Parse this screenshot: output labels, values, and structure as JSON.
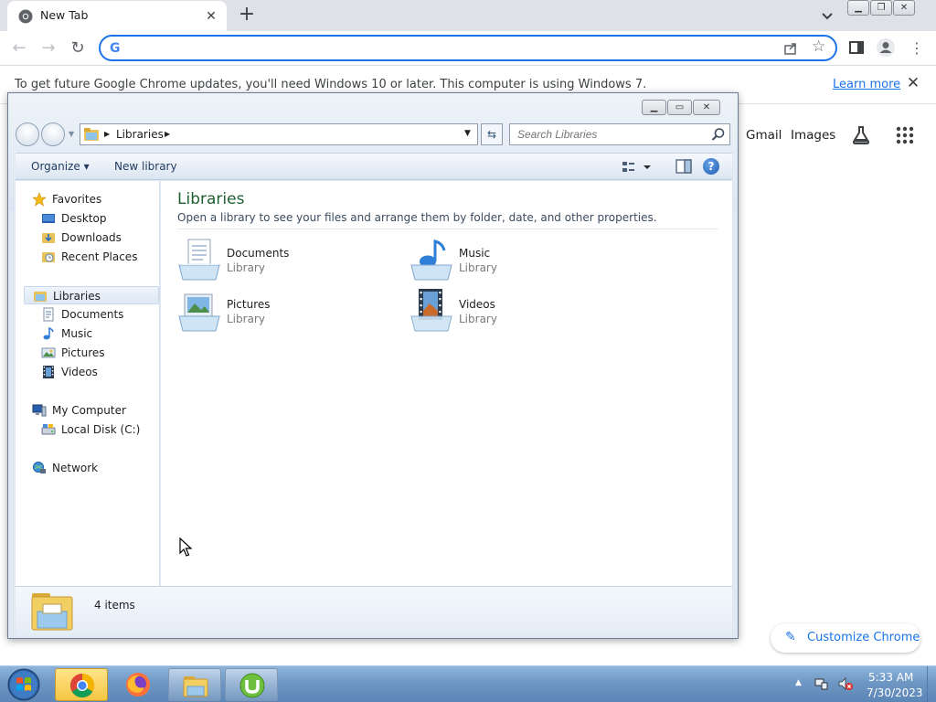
{
  "chrome": {
    "tab_title": "New Tab",
    "omnibox_value": "",
    "omnibox_placeholder": "",
    "infobar_message": "To get future Google Chrome updates, you'll need Windows 10 or later. This computer is using Windows 7.",
    "infobar_link": "Learn more",
    "ntp_links": {
      "gmail": "Gmail",
      "images": "Images"
    },
    "customize_label": "Customize Chrome",
    "accent_color": "#1a73e8"
  },
  "explorer": {
    "breadcrumb": [
      "Libraries"
    ],
    "search_placeholder": "Search Libraries",
    "toolbar": {
      "organize": "Organize",
      "new_library": "New library"
    },
    "nav": {
      "favorites": "Favorites",
      "favorites_items": [
        "Desktop",
        "Downloads",
        "Recent Places"
      ],
      "libraries": "Libraries",
      "libraries_items": [
        "Documents",
        "Music",
        "Pictures",
        "Videos"
      ],
      "computer": "My Computer",
      "computer_items": [
        "Local Disk (C:)"
      ],
      "network": "Network"
    },
    "content": {
      "title": "Libraries",
      "subtitle": "Open a library to see your files and arrange them by folder, date, and other properties.",
      "items": [
        {
          "name": "Documents",
          "type": "Library",
          "icon": "documents-library-icon"
        },
        {
          "name": "Music",
          "type": "Library",
          "icon": "music-library-icon"
        },
        {
          "name": "Pictures",
          "type": "Library",
          "icon": "pictures-library-icon"
        },
        {
          "name": "Videos",
          "type": "Library",
          "icon": "videos-library-icon"
        }
      ]
    },
    "details": {
      "count": "4 items"
    }
  },
  "taskbar": {
    "apps": [
      "chrome-icon",
      "firefox-icon",
      "explorer-icon",
      "utorrent-icon"
    ],
    "time": "5:33 AM",
    "date": "7/30/2023"
  }
}
